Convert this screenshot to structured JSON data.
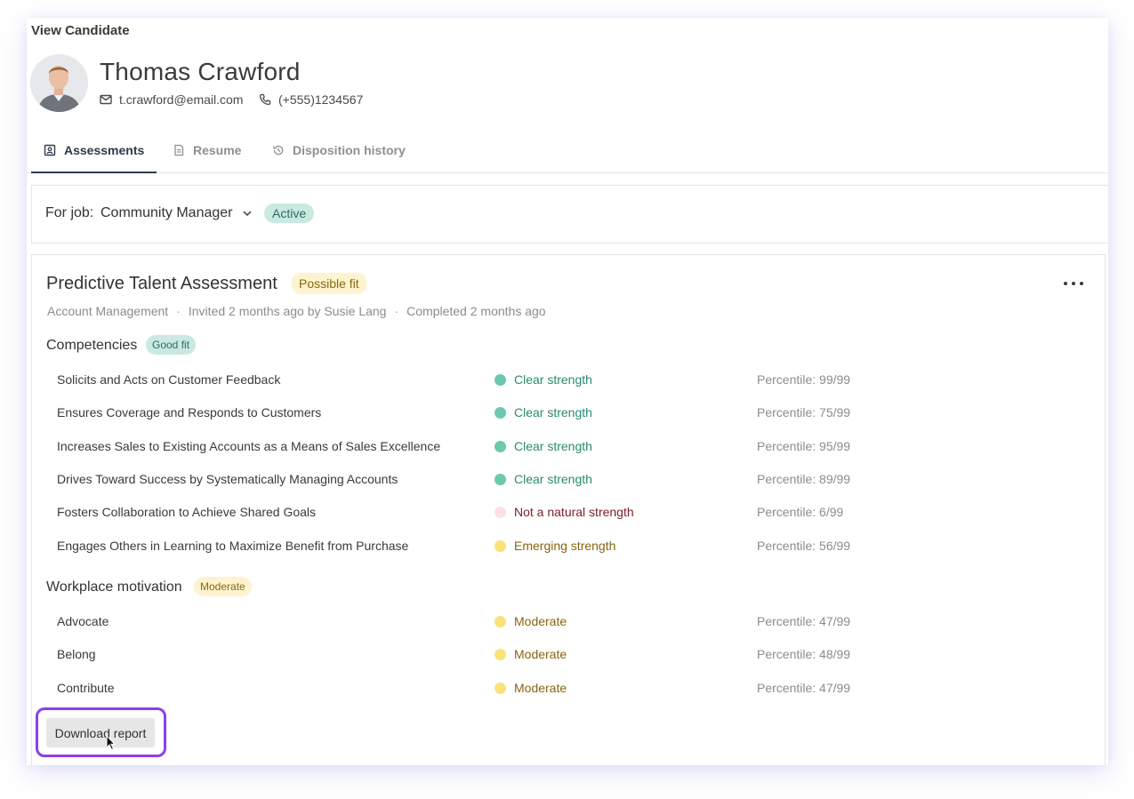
{
  "window": {
    "title": "View Candidate"
  },
  "candidate": {
    "name": "Thomas Crawford",
    "email": "t.crawford@email.com",
    "phone": "(+555)1234567"
  },
  "tabs": [
    {
      "label": "Assessments",
      "icon": "assessment-icon",
      "active": true
    },
    {
      "label": "Resume",
      "icon": "document-icon",
      "active": false
    },
    {
      "label": "Disposition history",
      "icon": "history-icon",
      "active": false
    }
  ],
  "job": {
    "label": "For job:",
    "name": "Community Manager",
    "status": "Active"
  },
  "assessment": {
    "title": "Predictive Talent Assessment",
    "fit_badge": "Possible fit",
    "meta": [
      "Account Management",
      "Invited 2 months ago by Susie Lang",
      "Completed 2 months ago"
    ],
    "competencies": {
      "title": "Competencies",
      "badge": "Good fit",
      "rows": [
        {
          "name": "Solicits and Acts on Customer Feedback",
          "status": "Clear strength",
          "percentile": "Percentile: 99/99"
        },
        {
          "name": "Ensures Coverage and Responds to Customers",
          "status": "Clear strength",
          "percentile": "Percentile: 75/99"
        },
        {
          "name": "Increases Sales to Existing Accounts as a Means of Sales Excellence",
          "status": "Clear strength",
          "percentile": "Percentile: 95/99"
        },
        {
          "name": "Drives Toward Success by Systematically Managing Accounts",
          "status": "Clear strength",
          "percentile": "Percentile: 89/99"
        },
        {
          "name": "Fosters Collaboration to Achieve Shared Goals",
          "status": "Not a natural strength",
          "percentile": "Percentile: 6/99"
        },
        {
          "name": "Engages Others in Learning to Maximize Benefit from Purchase",
          "status": "Emerging strength",
          "percentile": "Percentile: 56/99"
        }
      ]
    },
    "motivation": {
      "title": "Workplace motivation",
      "badge": "Moderate",
      "rows": [
        {
          "name": "Advocate",
          "status": "Moderate",
          "percentile": "Percentile: 47/99"
        },
        {
          "name": "Belong",
          "status": "Moderate",
          "percentile": "Percentile: 48/99"
        },
        {
          "name": "Contribute",
          "status": "Moderate",
          "percentile": "Percentile: 47/99"
        }
      ]
    },
    "download_label": "Download report"
  },
  "colors": {
    "clear_strength": "#6cc9b0",
    "clear_strength_text": "#2a8a72",
    "not_natural": "#fbe1e3",
    "not_natural_text": "#7a1f2b",
    "emerging": "#f9e27a",
    "emerging_text": "#8a6412",
    "highlight": "#8a3ff0"
  }
}
